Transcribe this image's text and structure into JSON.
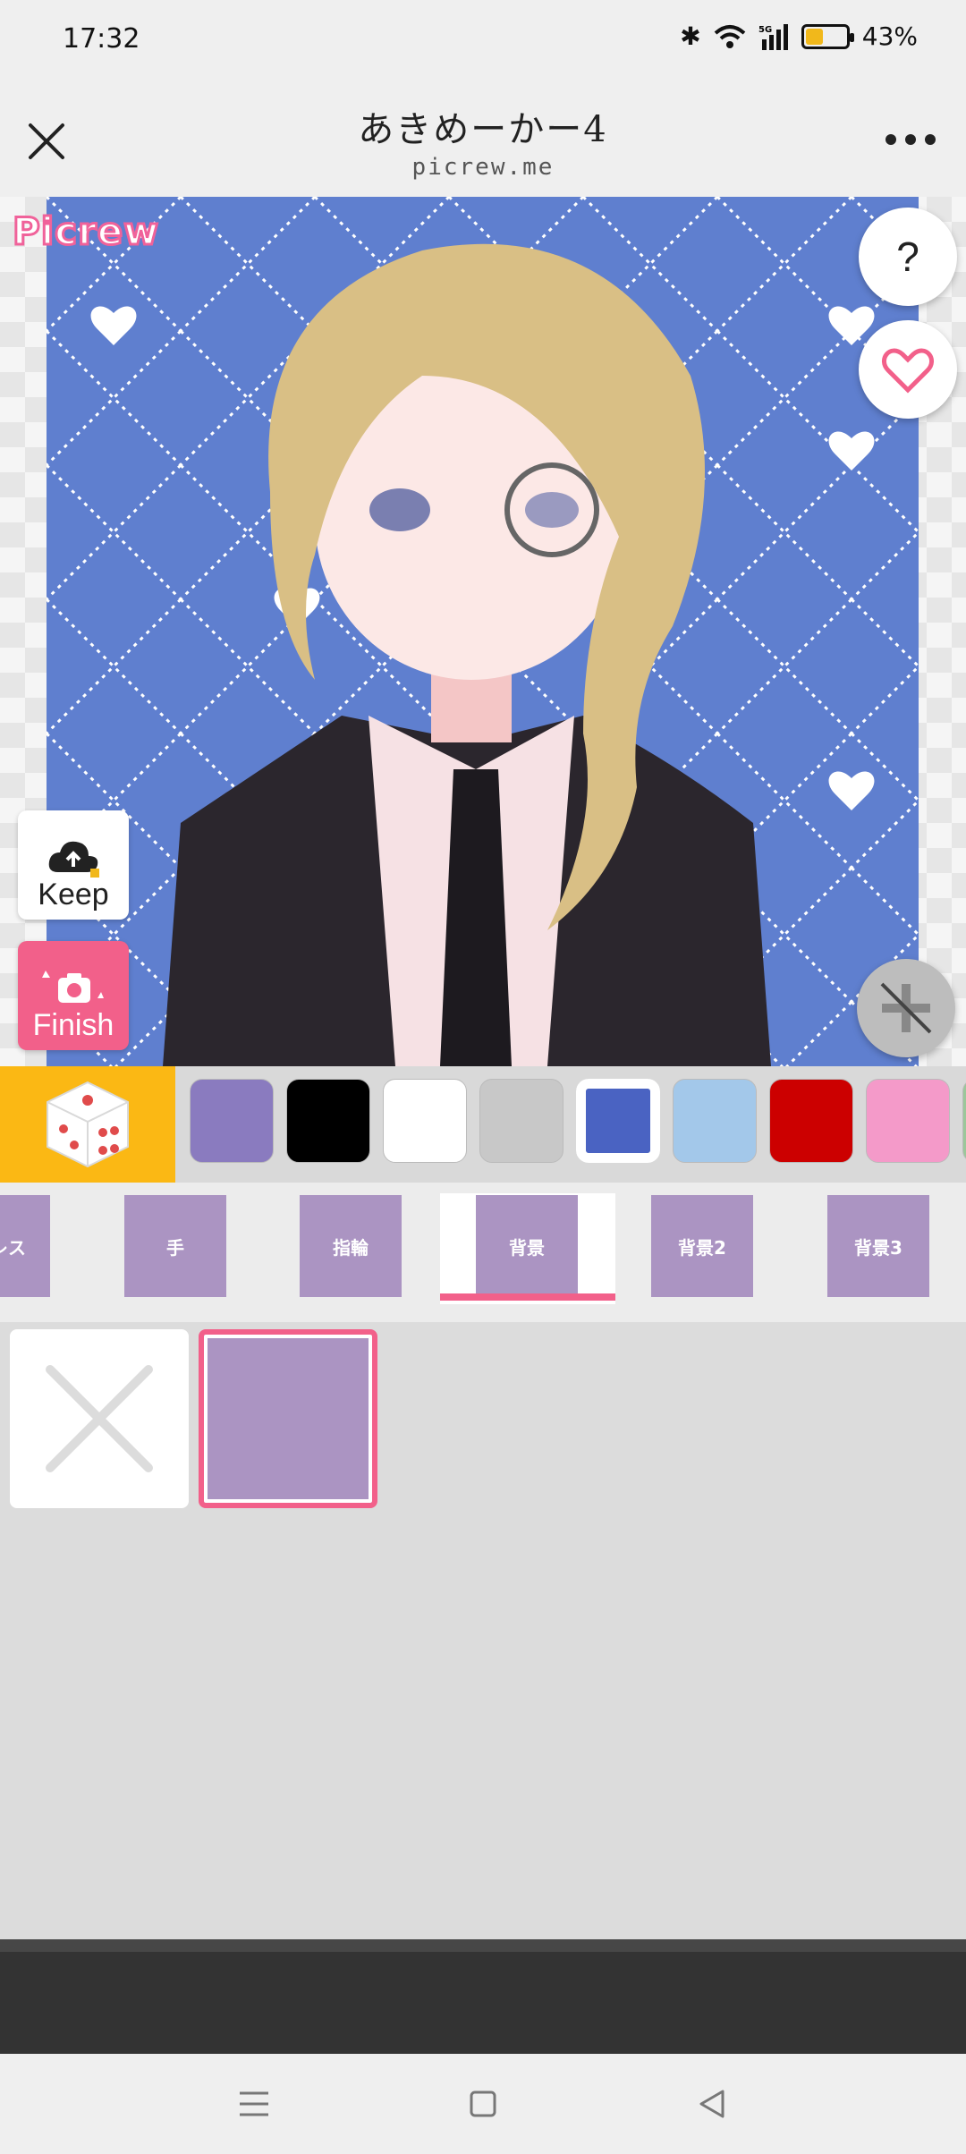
{
  "status_bar": {
    "time": "17:32",
    "battery_text": "43%",
    "battery_level": 0.43
  },
  "header": {
    "title": "あきめーかー4",
    "subtitle": "picrew.me"
  },
  "canvas": {
    "logo_text": "Picrew",
    "help_label": "?"
  },
  "actions": {
    "keep_label": "Keep",
    "finish_label": "Finish"
  },
  "colors": [
    "#8a7bbf",
    "#000000",
    "#ffffff",
    "#c8c8c8",
    "#4a63c2",
    "#a3c8ea",
    "#cc0000",
    "#f49ac9",
    "#9cc79a"
  ],
  "selected_color_index": 4,
  "tabs": [
    {
      "label": "ブレス"
    },
    {
      "label": "手"
    },
    {
      "label": "指輪"
    },
    {
      "label": "背景"
    },
    {
      "label": "背景2"
    },
    {
      "label": "背景3"
    }
  ],
  "active_tab_index": 3
}
